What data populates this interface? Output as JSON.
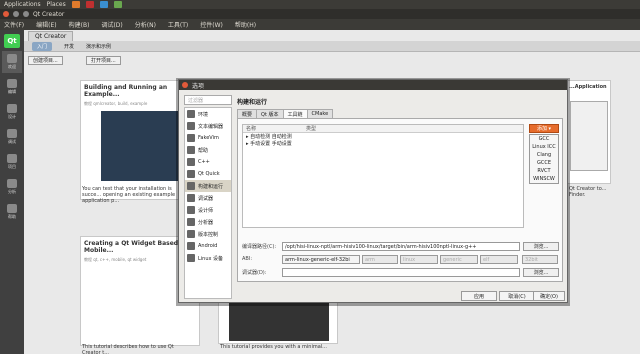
{
  "system_bar": {
    "applications": "Applications",
    "places": "Places"
  },
  "window": {
    "title": "Qt Creator"
  },
  "menubar": [
    "文件(F)",
    "编辑(E)",
    "构建(B)",
    "调试(D)",
    "分析(N)",
    "工具(T)",
    "控件(W)",
    "帮助(H)"
  ],
  "left_modes": [
    "欢迎",
    "编辑",
    "设计",
    "调试",
    "项目",
    "分析",
    "帮助"
  ],
  "welcome": {
    "tab": "Qt Creator",
    "subtabs": [
      "入门",
      "开发",
      "演示和示例"
    ],
    "buttons": [
      "创建项目...",
      "打开项目..."
    ],
    "cards": [
      {
        "title": "Building and Running an Example...",
        "sub": "教程 qmlcreator, build, example",
        "text": "You can test that your installation is succe... opening an existing example application p..."
      },
      {
        "title": "Creating a Qt Widget Based Mobile...",
        "sub": "教程 qt, c++, mobile, qt widget",
        "text": "This tutorial describes how to use Qt Creator t..."
      },
      {
        "title": "...Application",
        "sub": "",
        "text": "Qt Creator to... Finder."
      },
      {
        "title": "",
        "sub": "",
        "text": "This tutorial provides you with a minimal..."
      }
    ]
  },
  "dialog": {
    "title": "选项",
    "filter_placeholder": "过滤器",
    "nav": [
      "环境",
      "文本编辑器",
      "FakeVim",
      "帮助",
      "C++",
      "Qt Quick",
      "构建和运行",
      "调试器",
      "设计师",
      "分析器",
      "版本控制",
      "Android",
      "Linux 设备"
    ],
    "heading": "构建和运行",
    "tabs": [
      "概要",
      "Qt 版本",
      "工具链",
      "CMake"
    ],
    "tree": {
      "columns": [
        "名称",
        "类型"
      ],
      "rows": [
        "▸ 自动检测 自动检测",
        "▸ 手动设置 手动设置"
      ]
    },
    "add_button": "添加",
    "add_menu": [
      "GCC",
      "Linux ICC",
      "Clang",
      "GCCE",
      "RVCT",
      "WINSCW"
    ],
    "form": {
      "compiler_label": "编译器路径(C):",
      "compiler_path": "/opt/hisi-linux-nptl/arm-hisiv100-linux/target/bin/arm-hisiv100nptl-linux-g++",
      "abi_label": "ABI:",
      "abi_values": [
        "arm-linux-generic-elf-32bi",
        "arm",
        "linux",
        "generic",
        "elf",
        "32bit"
      ],
      "debugger_label": "调试器(D):",
      "debugger_value": "",
      "browse": "浏览..."
    },
    "buttons": [
      "应用",
      "取消(C)",
      "确定(O)"
    ]
  }
}
